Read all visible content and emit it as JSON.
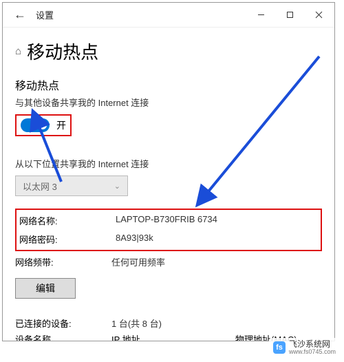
{
  "titlebar": {
    "app_title": "设置"
  },
  "page": {
    "title": "移动热点",
    "section_title": "移动热点",
    "section_sub": "与其他设备共享我的 Internet 连接",
    "toggle_state_label": "开",
    "share_from_label": "从以下位置共享我的 Internet 连接",
    "share_from_value": "以太网 3"
  },
  "network": {
    "name_label": "网络名称:",
    "name_value": "LAPTOP-B730FRIB 6734",
    "password_label": "网络密码:",
    "password_value": "8A93|93k",
    "band_label": "网络频带:",
    "band_value": "任何可用频率",
    "edit_label": "编辑"
  },
  "devices": {
    "connected_label": "已连接的设备:",
    "connected_value": "1 台(共 8 台)",
    "col_name": "设备名称",
    "col_ip": "IP 地址",
    "col_mac": "物理地址(MAC)"
  },
  "watermark": {
    "name": "飞沙系统网",
    "url": "www.fs0745.com"
  }
}
